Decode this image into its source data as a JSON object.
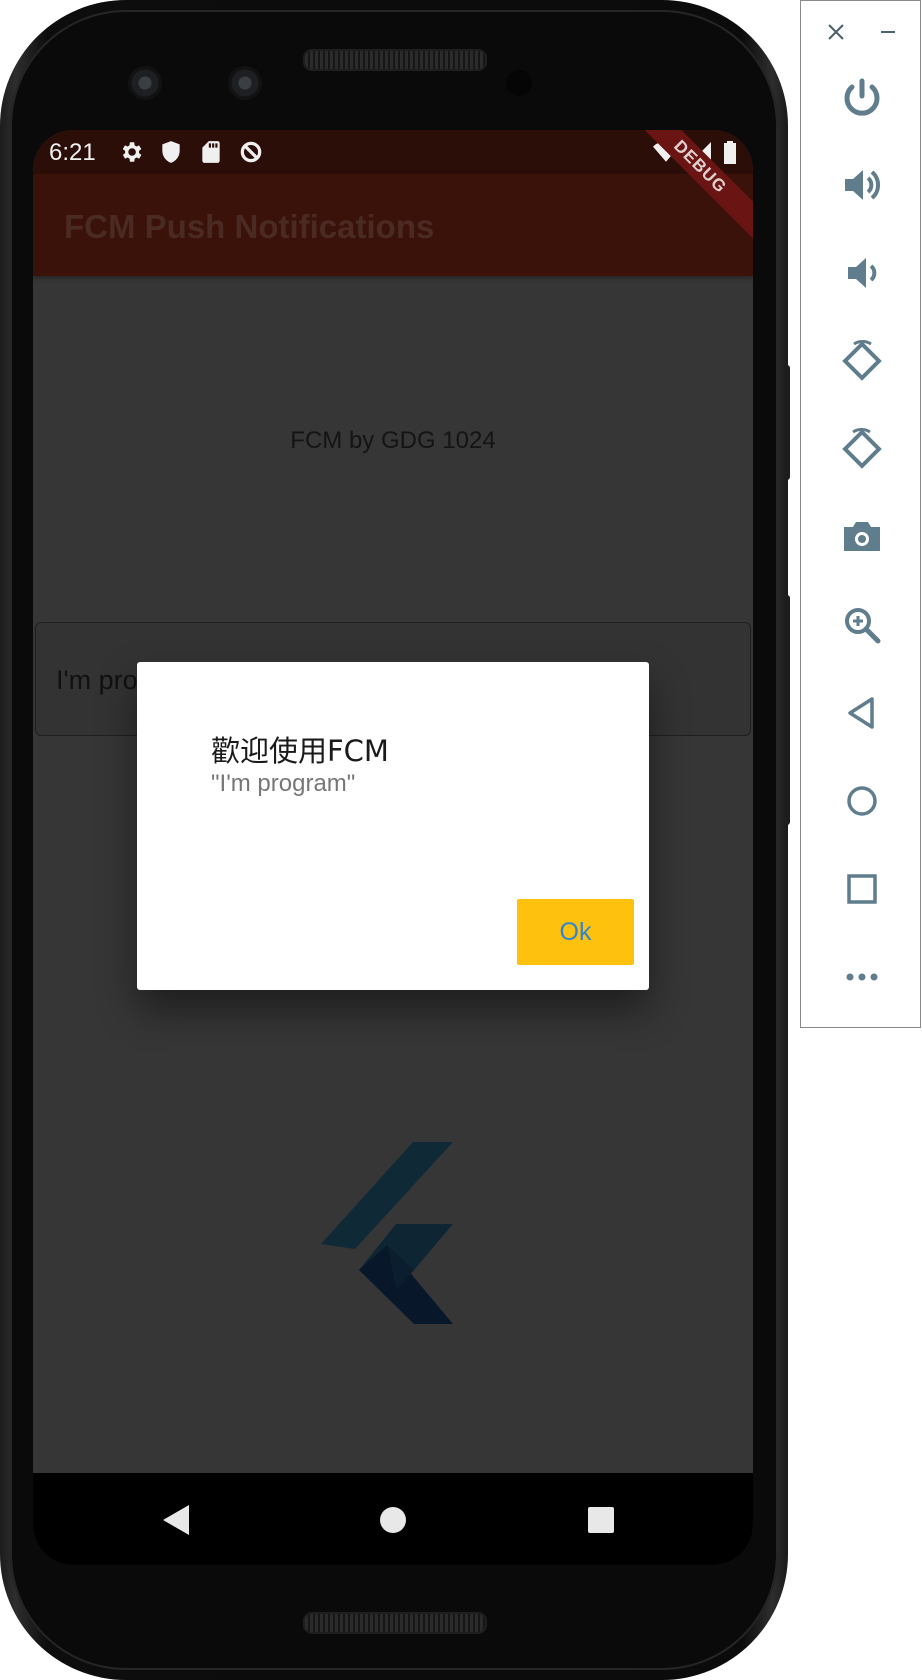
{
  "status_bar": {
    "time": "6:21",
    "icons": [
      "settings-icon",
      "shield-icon",
      "sd-card-icon",
      "data-saver-icon"
    ],
    "right_icons": [
      "wifi-icon",
      "signal-icon",
      "battery-icon"
    ]
  },
  "app_bar": {
    "title": "FCM Push Notifications",
    "debug_label": "DEBUG"
  },
  "main": {
    "subtitle": "FCM by GDG 1024",
    "message_text": "I'm pro"
  },
  "dialog": {
    "title": "歡迎使用FCM",
    "body": "\"I'm program\"",
    "ok_label": "Ok"
  },
  "nav_bar": [
    "back-icon",
    "home-icon",
    "recents-icon"
  ],
  "emulator_toolbar": {
    "window_controls": [
      "close-icon",
      "minimize-icon"
    ],
    "buttons": [
      "power-icon",
      "volume-up-icon",
      "volume-down-icon",
      "rotate-left-icon",
      "rotate-right-icon",
      "camera-icon",
      "zoom-icon",
      "back-icon",
      "home-icon",
      "overview-icon",
      "more-icon"
    ]
  },
  "colors": {
    "status_bar": "#2c0e08",
    "app_bar": "#3a120a",
    "background": "#363636",
    "ok_button": "#fec10e",
    "ok_text": "#2f85d4",
    "toolbar_icon": "#5f7d8c"
  }
}
